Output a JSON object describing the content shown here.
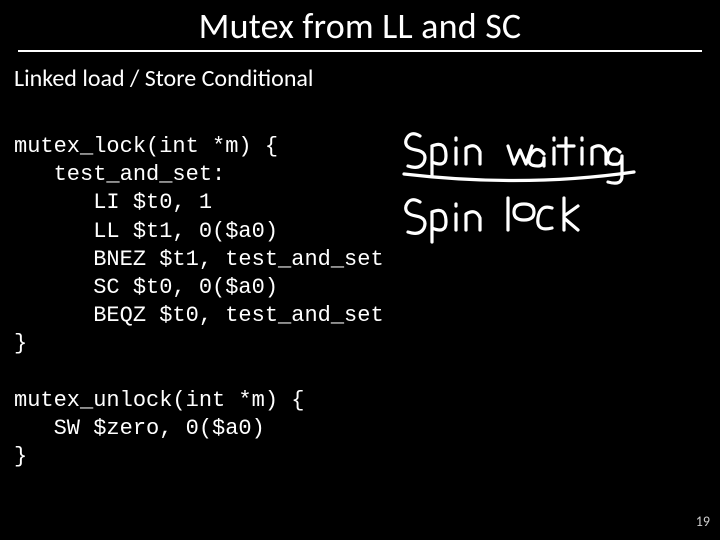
{
  "title": "Mutex from LL and SC",
  "subhead": "Linked load / Store Conditional",
  "code": {
    "lock_sig": "mutex_lock(int *m) {",
    "label": "   test_and_set:",
    "li": "      LI $t0, 1",
    "ll": "      LL $t1, 0($a0)",
    "bnez": "      BNEZ $t1, test_and_set",
    "sc": "      SC $t0, 0($a0)",
    "beqz": "      BEQZ $t0, test_and_set",
    "lock_end": "}",
    "blank": "",
    "unlock_sig": "mutex_unlock(int *m) {",
    "sw": "   SW $zero, 0($a0)",
    "unlock_end": "}"
  },
  "annotations": {
    "line1": "Spin waiting",
    "line2": "Spin lock"
  },
  "page_number": "19"
}
